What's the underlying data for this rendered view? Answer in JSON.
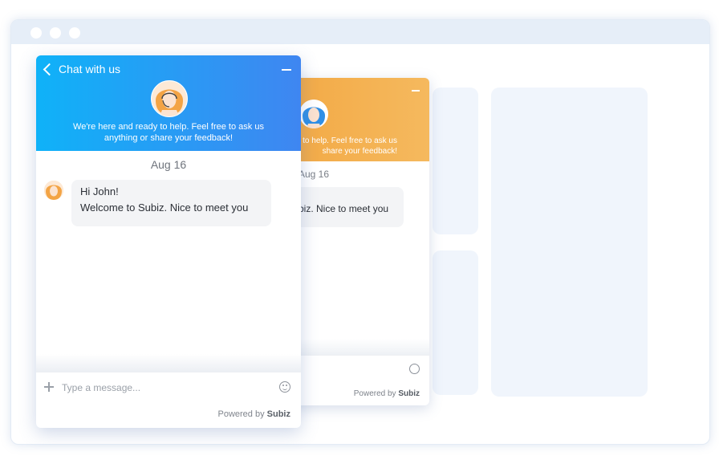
{
  "front_widget": {
    "title": "Chat with us",
    "intro_line1": "We're here and ready to help. Feel free to ask us",
    "intro_line2": "anything or share your feedback!",
    "date": "Aug 16",
    "message_line1": "Hi John!",
    "message_line2": "Welcome to Subiz. Nice to meet you",
    "input_placeholder": "Type a message...",
    "powered_prefix": "Powered by",
    "powered_brand": "Subiz",
    "header_gradient": [
      "#0fb2f8",
      "#3f86f1"
    ]
  },
  "back_widget": {
    "intro_line1": "y to help. Feel free to ask us",
    "intro_line2": "share your feedback!",
    "date": "Aug 16",
    "message": "biz. Nice to meet you",
    "powered_prefix": "Powered by",
    "powered_brand": "Subiz",
    "header_gradient": [
      "#f2a640",
      "#f5b95e"
    ]
  }
}
